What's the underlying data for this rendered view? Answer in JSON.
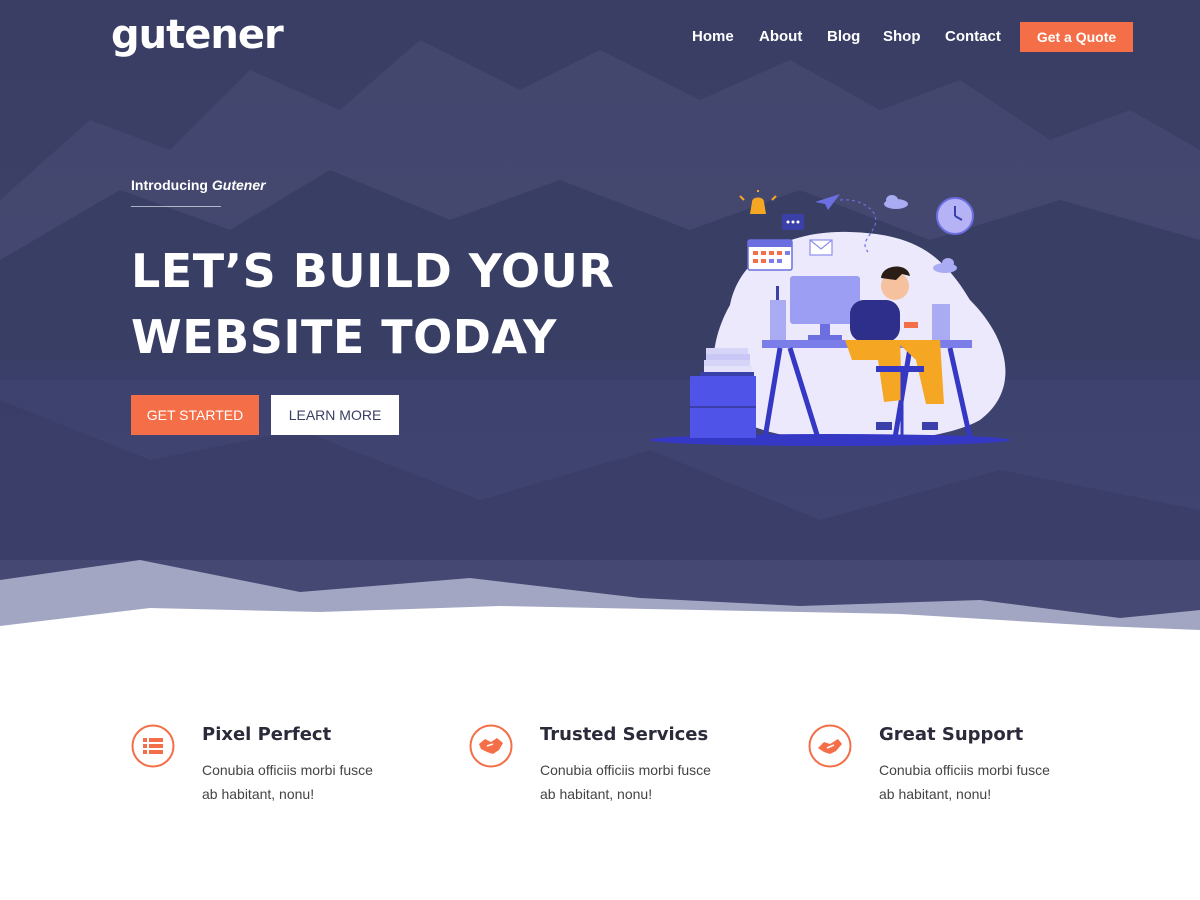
{
  "header": {
    "logo": "gutener",
    "nav": [
      "Home",
      "About",
      "Blog",
      "Shop",
      "Contact"
    ],
    "cta": "Get a Quote"
  },
  "hero": {
    "intro_prefix": "Introducing",
    "intro_brand": "Gutener",
    "headline_line1": "LET’S BUILD YOUR",
    "headline_line2": "WEBSITE TODAY",
    "primary_button": "GET STARTED",
    "secondary_button": "LEARN MORE"
  },
  "features": [
    {
      "icon": "list-icon",
      "title": "Pixel Perfect",
      "desc_line1": "Conubia officiis morbi fusce",
      "desc_line2": "ab habitant, nonu!"
    },
    {
      "icon": "handshake-icon",
      "title": "Trusted Services",
      "desc_line1": "Conubia officiis morbi fusce",
      "desc_line2": "ab habitant, nonu!"
    },
    {
      "icon": "handshake-icon",
      "title": "Great Support",
      "desc_line1": "Conubia officiis morbi fusce",
      "desc_line2": "ab habitant, nonu!"
    }
  ],
  "colors": {
    "accent": "#f46e47",
    "hero_bg": "#3c4068",
    "illustration_blob": "#ebe9fb",
    "illustration_purple": "#5b5ef0"
  }
}
